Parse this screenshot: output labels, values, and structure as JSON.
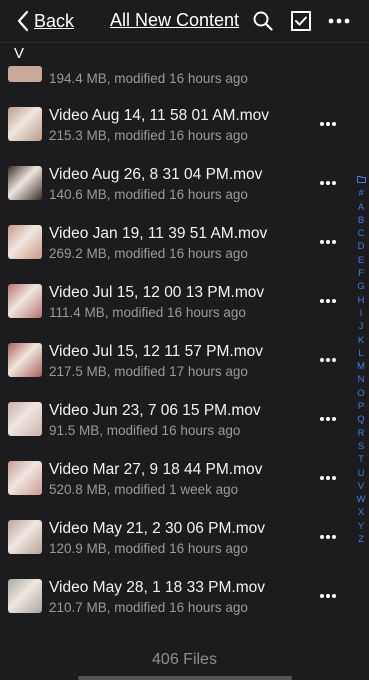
{
  "header": {
    "back_label": "Back",
    "title": "All New Content"
  },
  "section_letter": "V",
  "partial_row": {
    "meta": "194.4 MB, modified 16 hours ago"
  },
  "files": [
    {
      "name": "Video Aug 14, 11 58 01 AM.mov",
      "meta": "215.3 MB, modified 16 hours ago",
      "thumb": "#b89a8a"
    },
    {
      "name": "Video Aug 26, 8 31 04 PM.mov",
      "meta": "140.6 MB, modified 16 hours ago",
      "thumb": "#3a2e28"
    },
    {
      "name": "Video Jan 19, 11 39 51 AM.mov",
      "meta": "269.2 MB, modified 16 hours ago",
      "thumb": "#c89a86"
    },
    {
      "name": "Video Jul 15, 12 00 13 PM.mov",
      "meta": "111.4 MB, modified 16 hours ago",
      "thumb": "#b87070"
    },
    {
      "name": "Video Jul 15, 12 11 57 PM.mov",
      "meta": "217.5 MB, modified 17 hours ago",
      "thumb": "#a86058"
    },
    {
      "name": "Video Jun 23, 7 06 15 PM.mov",
      "meta": "91.5 MB, modified 16 hours ago",
      "thumb": "#c8b0aa"
    },
    {
      "name": "Video Mar 27, 9 18 44 PM.mov",
      "meta": "520.8 MB, modified 1 week ago",
      "thumb": "#c89a94"
    },
    {
      "name": "Video May 21, 2 30 06 PM.mov",
      "meta": "120.9 MB, modified 16 hours ago",
      "thumb": "#b8a39a"
    },
    {
      "name": "Video May 28, 1 18 33 PM.mov",
      "meta": "210.7 MB, modified 16 hours ago",
      "thumb": "#a8a6a0"
    }
  ],
  "index_letters": [
    "#",
    "A",
    "B",
    "C",
    "D",
    "E",
    "F",
    "G",
    "H",
    "I",
    "J",
    "K",
    "L",
    "M",
    "N",
    "O",
    "P",
    "Q",
    "R",
    "S",
    "T",
    "U",
    "V",
    "W",
    "X",
    "Y",
    "Z"
  ],
  "index_folder_icon": "folder-icon",
  "footer": "406 Files",
  "colors": {
    "accent": "#3f7ee8",
    "background": "#1c1c1e",
    "meta_text": "#9a9a9a"
  }
}
